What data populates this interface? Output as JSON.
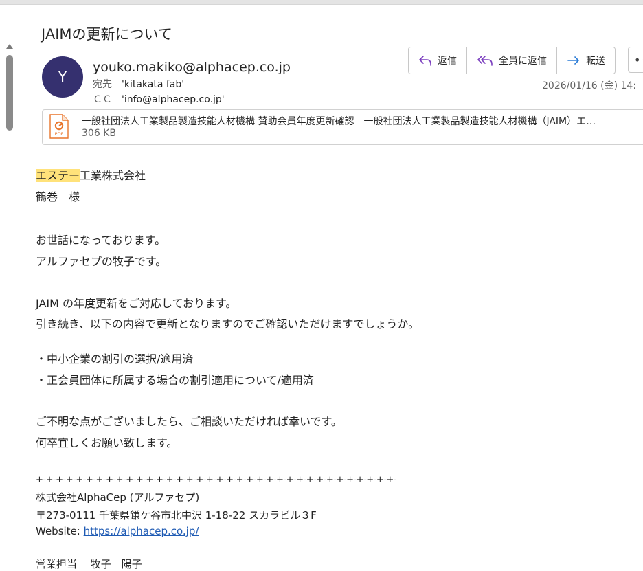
{
  "subject": "JAIMの更新について",
  "sender": {
    "avatar_initial": "Y",
    "email": "youko.makiko@alphacep.co.jp",
    "to_label": "宛先",
    "to_value": "'kitakata fab'",
    "cc_label": "ＣＣ",
    "cc_value": "'info@alphacep.co.jp'"
  },
  "actions": {
    "reply": "返信",
    "reply_all": "全員に返信",
    "forward": "転送",
    "more": "•••"
  },
  "date": "2026/01/16 (金) 14:",
  "attachment": {
    "name": "一般社団法人工業製品製造技能人材機構 賛助会員年度更新確認｜一般社団法人工業製品製造技能人材機構（JAIM）エ…",
    "size": "306 KB",
    "icon_label": "PDF"
  },
  "body": {
    "company_highlight": "エステー",
    "company_rest": "工業株式会社",
    "addressee": "鶴巻　様",
    "greeting1": "お世話になっております。",
    "greeting2": "アルファセプの牧子です。",
    "para1": "JAIM の年度更新をご対応しております。",
    "para2": "引き続き、以下の内容で更新となりますのでご確認いただけますでしょうか。",
    "bullet1": "・中小企業の割引の選択/適用済",
    "bullet2": "・正会員団体に所属する場合の割引適用について/適用済",
    "closing1": "ご不明な点がございましたら、ご相談いただければ幸いです。",
    "closing2": "何卒宜しくお願い致します。"
  },
  "signature": {
    "separator": "+-+-+-+-+-+-+-+-+-+-+-+-+-+-+-+-+-+-+-+-+-+-+-+-+-+-+-+-+-+-+-+-+-+-+-+-",
    "company": "株式会社AlphaCep (アルファセプ)",
    "address": "〒273-0111 千葉県鎌ケ谷市北中沢 1-18-22 スカラビル３F",
    "website_label": "Website: ",
    "website_url": "https://alphacep.co.jp/",
    "contact": "営業担当　 牧子　陽子"
  },
  "colors": {
    "avatar_bg": "#35306f",
    "reply_icon": "#7b3fbf",
    "forward_icon": "#2b7bd6",
    "highlight": "#ffe27a",
    "link": "#1f5bb4"
  }
}
